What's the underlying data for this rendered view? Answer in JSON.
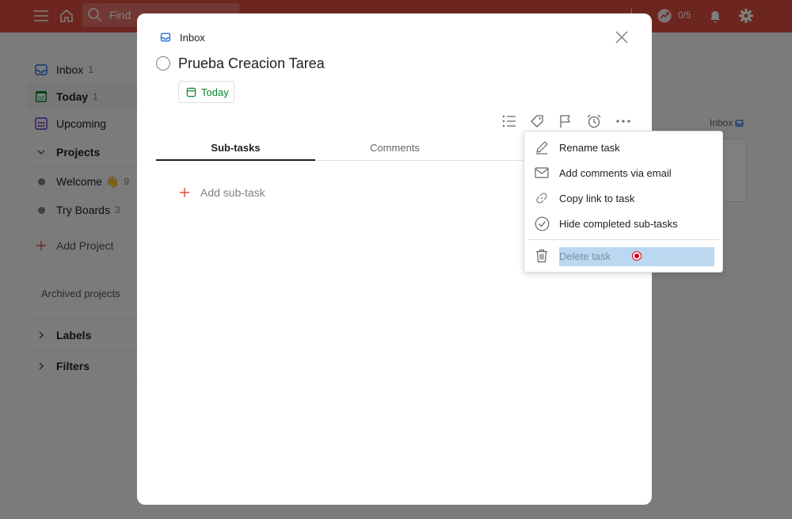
{
  "topbar": {
    "search_placeholder": "Find",
    "karma": "0/5",
    "icons": [
      "menu-icon",
      "home-icon",
      "search-icon",
      "karma-icon",
      "bell-icon",
      "gear-icon"
    ]
  },
  "sidebar": {
    "items": [
      {
        "label": "Inbox",
        "count": "1",
        "icon": "inbox-icon"
      },
      {
        "label": "Today",
        "count": "1",
        "icon": "calendar-today-icon",
        "day": "02"
      },
      {
        "label": "Upcoming",
        "count": "",
        "icon": "calendar-upcoming-icon"
      }
    ],
    "projects_label": "Projects",
    "projects": [
      {
        "label": "Welcome 👋",
        "count": "9"
      },
      {
        "label": "Try Boards",
        "count": "3"
      }
    ],
    "add_project": "Add Project",
    "archived": "Archived projects",
    "labels": "Labels",
    "filters": "Filters"
  },
  "background": {
    "inbox_label": "Inbox"
  },
  "modal": {
    "project": "Inbox",
    "task_title": "Prueba Creacion Tarea",
    "due": "Today",
    "tabs": [
      {
        "label": "Sub-tasks",
        "active": true
      },
      {
        "label": "Comments",
        "active": false
      }
    ],
    "add_subtask": "Add sub-task"
  },
  "menu": {
    "items": [
      {
        "label": "Rename task",
        "icon": "pencil-icon"
      },
      {
        "label": "Add comments via email",
        "icon": "envelope-icon"
      },
      {
        "label": "Copy link to task",
        "icon": "link-icon"
      },
      {
        "label": "Hide completed sub-tasks",
        "icon": "check-circle-icon"
      },
      {
        "label": "Delete task",
        "icon": "trash-icon"
      }
    ]
  },
  "colors": {
    "brand": "#db4c3f",
    "today_green": "#058527",
    "selection": "#bcd7f0",
    "cursor": "#e2001a"
  }
}
